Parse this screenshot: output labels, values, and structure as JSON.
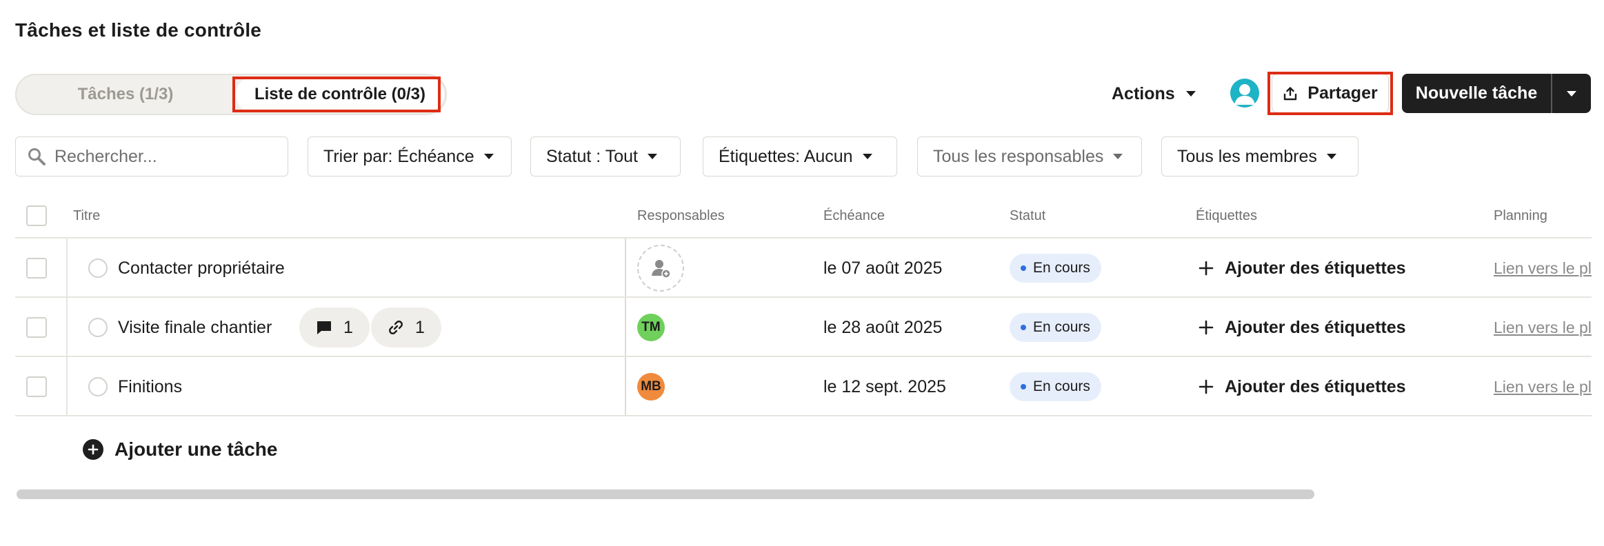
{
  "page": {
    "title": "Tâches et liste de contrôle"
  },
  "tabs": [
    {
      "label": "Tâches (1/3)",
      "active": false
    },
    {
      "label": "Liste de contrôle (0/3)",
      "active": true
    }
  ],
  "toolbar": {
    "actions_label": "Actions",
    "share_label": "Partager",
    "new_task_label": "Nouvelle tâche"
  },
  "filters": {
    "search_placeholder": "Rechercher...",
    "sort": "Trier par: Échéance",
    "status": "Statut : Tout",
    "tags": "Étiquettes: Aucun",
    "assignees": "Tous les responsables",
    "members": "Tous les membres"
  },
  "table": {
    "headers": {
      "title": "Titre",
      "assignees": "Responsables",
      "due": "Échéance",
      "status": "Statut",
      "tags": "Étiquettes",
      "planning": "Planning"
    },
    "rows": [
      {
        "title": "Contacter propriétaire",
        "assignee": "",
        "due": "le 07 août 2025",
        "status": "En cours",
        "tags": "Ajouter des étiquettes",
        "planning": "Lien vers le pl",
        "comments": "",
        "links": ""
      },
      {
        "title": "Visite finale chantier",
        "assignee": "TM",
        "assignee_color": "#6fd05c",
        "due": "le 28 août 2025",
        "status": "En cours",
        "tags": "Ajouter des étiquettes",
        "planning": "Lien vers le pl",
        "comments": "1",
        "links": "1"
      },
      {
        "title": "Finitions",
        "assignee": "MB",
        "assignee_color": "#f08a3c",
        "due": "le 12 sept. 2025",
        "status": "En cours",
        "tags": "Ajouter des étiquettes",
        "planning": "Lien vers le pl",
        "comments": "",
        "links": ""
      }
    ]
  },
  "footer": {
    "add_task_label": "Ajouter une tâche"
  },
  "colors": {
    "highlight": "#dd2c14",
    "primary_button": "#1f1f1f",
    "status_dot": "#2f6fde",
    "avatar_user": "#1fb3c6"
  }
}
